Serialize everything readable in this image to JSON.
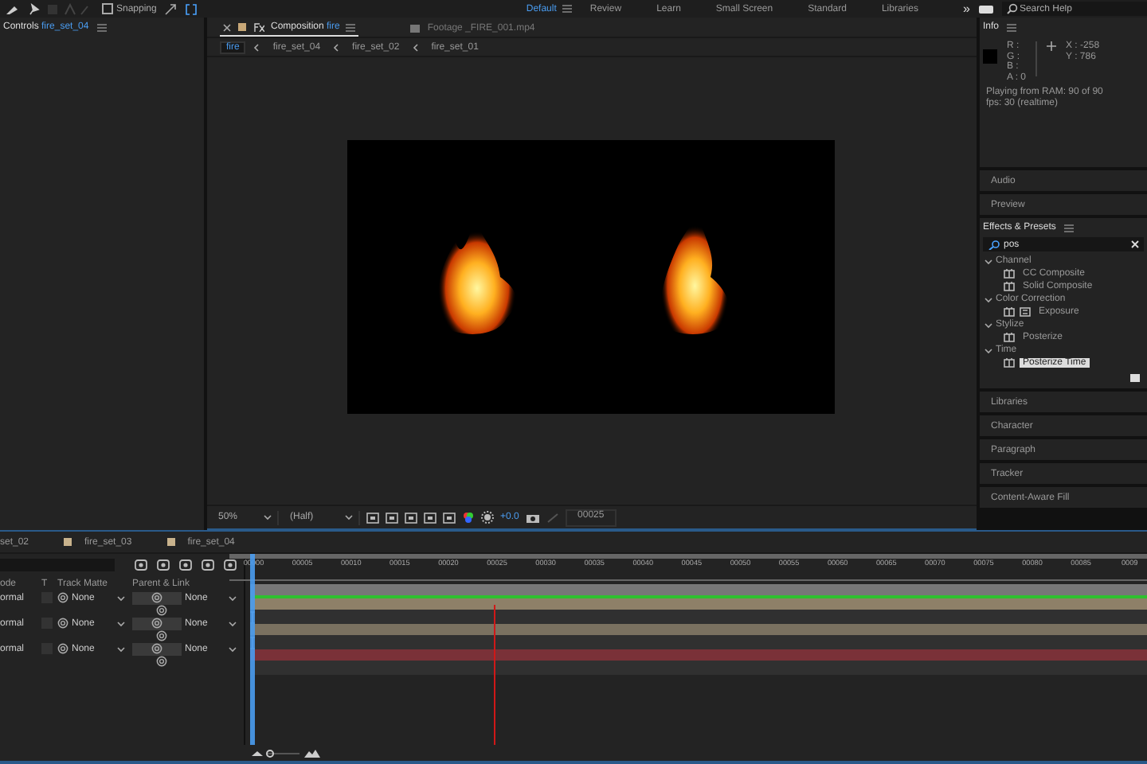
{
  "toolbar": {
    "snapping": {
      "label": "Snapping",
      "checked": false
    },
    "workspaces": [
      {
        "label": "Default",
        "selected": true
      },
      {
        "label": "Review",
        "selected": false
      },
      {
        "label": "Learn",
        "selected": false
      },
      {
        "label": "Small Screen",
        "selected": false
      },
      {
        "label": "Standard",
        "selected": false
      },
      {
        "label": "Libraries",
        "selected": false
      }
    ],
    "overflow": "»",
    "search": {
      "placeholder": "Search Help"
    }
  },
  "controls_panel": {
    "title": "Controls",
    "layer": "fire_set_04"
  },
  "viewer": {
    "tabs": [
      {
        "kind": "composition",
        "label": "Composition",
        "name": "fire",
        "selected": true
      },
      {
        "kind": "footage",
        "label": "Footage",
        "name": "_FIRE_001.mp4",
        "selected": false
      }
    ],
    "breadcrumbs": [
      {
        "label": "fire",
        "selected": true
      },
      {
        "label": "fire_set_04",
        "selected": false
      },
      {
        "label": "fire_set_02",
        "selected": false
      },
      {
        "label": "fire_set_01",
        "selected": false
      }
    ],
    "zoom": "50%",
    "resolution": "(Half)",
    "exposure": "+0.0",
    "timecode": "00025"
  },
  "info_panel": {
    "title": "Info",
    "channels": [
      "R :",
      "G :",
      "B :",
      "A : 0"
    ],
    "coords": [
      "X : -258",
      "Y : 786"
    ],
    "status": [
      "Playing from RAM: 90 of 90",
      "fps: 30 (realtime)"
    ]
  },
  "panels_top": [
    "Audio",
    "Preview"
  ],
  "effects_presets": {
    "title": "Effects & Presets",
    "search": "pos",
    "groups": [
      {
        "label": "Channel",
        "expanded": true,
        "children": [
          {
            "label": "CC Composite",
            "selected": false
          },
          {
            "label": "Solid Composite",
            "selected": false
          }
        ]
      },
      {
        "label": "Color Correction",
        "expanded": true,
        "children": [
          {
            "label": "Exposure",
            "selected": false
          }
        ]
      },
      {
        "label": "Stylize",
        "expanded": true,
        "children": [
          {
            "label": "Posterize",
            "selected": false
          }
        ]
      },
      {
        "label": "Time",
        "expanded": true,
        "children": [
          {
            "label": "Posterize Time",
            "selected": true
          }
        ]
      }
    ]
  },
  "panels_bottom": [
    "Libraries",
    "Character",
    "Paragraph",
    "Tracker",
    "Content-Aware Fill"
  ],
  "timeline": {
    "tabs": [
      {
        "label": "set_02"
      },
      {
        "label": "fire_set_03",
        "color": "#c8b28c"
      },
      {
        "label": "fire_set_04",
        "color": "#c8b28c"
      }
    ],
    "zoom_slider": {
      "level": 0.05
    },
    "columns": [
      "ode",
      "T",
      "Track Matte",
      "Parent & Link"
    ],
    "ruler": [
      "00000",
      "00005",
      "00010",
      "00015",
      "00020",
      "00025",
      "00030",
      "00035",
      "00040",
      "00045",
      "00050",
      "00055",
      "00060",
      "00065",
      "00070",
      "00075",
      "00080",
      "00085",
      "0009"
    ],
    "layers": [
      {
        "mode": "ormal",
        "preserve_transparency": false,
        "track_matte": "None",
        "parent": "None",
        "color": "#8e8068"
      },
      {
        "mode": "ormal",
        "preserve_transparency": false,
        "track_matte": "None",
        "parent": "None",
        "color": "#7a7160"
      },
      {
        "mode": "ormal",
        "preserve_transparency": false,
        "track_matte": "None",
        "parent": "None",
        "color": "#7a3138"
      }
    ]
  }
}
